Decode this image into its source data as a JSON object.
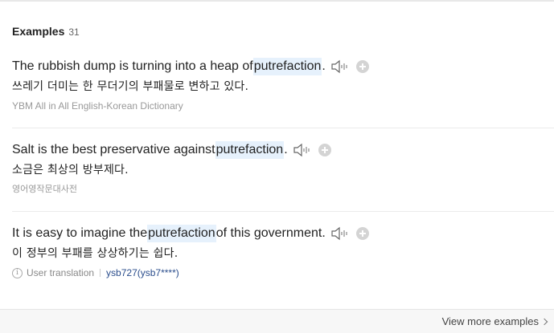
{
  "header": {
    "title": "Examples",
    "count": "31"
  },
  "examples": [
    {
      "before": "The rubbish dump is turning into a heap of ",
      "highlight": "putrefaction",
      "after": ".",
      "translation": "쓰레기 더미는 한 무더기의 부패물로 변하고 있다.",
      "source": "YBM All in All English-Korean Dictionary"
    },
    {
      "before": "Salt is the best preservative against ",
      "highlight": "putrefaction",
      "after": ".",
      "translation": "소금은 최상의 방부제다.",
      "source": "영어영작문대사전"
    },
    {
      "before": "It is easy to imagine the ",
      "highlight": "putrefaction",
      "after": " of this government.",
      "translation": "이 정부의 부패를 상상하기는 쉽다.",
      "user_label": "User translation",
      "user_link": "ysb727(ysb7****)"
    }
  ],
  "footer": {
    "more_label": "View more examples"
  },
  "icons": {
    "sound": "speaker-icon",
    "add": "plus-circle-icon",
    "info": "info-icon",
    "more": "chevron-right-icon"
  },
  "colors": {
    "highlight_bg": "#e6f1fc",
    "user_link": "#2a4d8c",
    "add_icon": "#d4d4d4"
  }
}
